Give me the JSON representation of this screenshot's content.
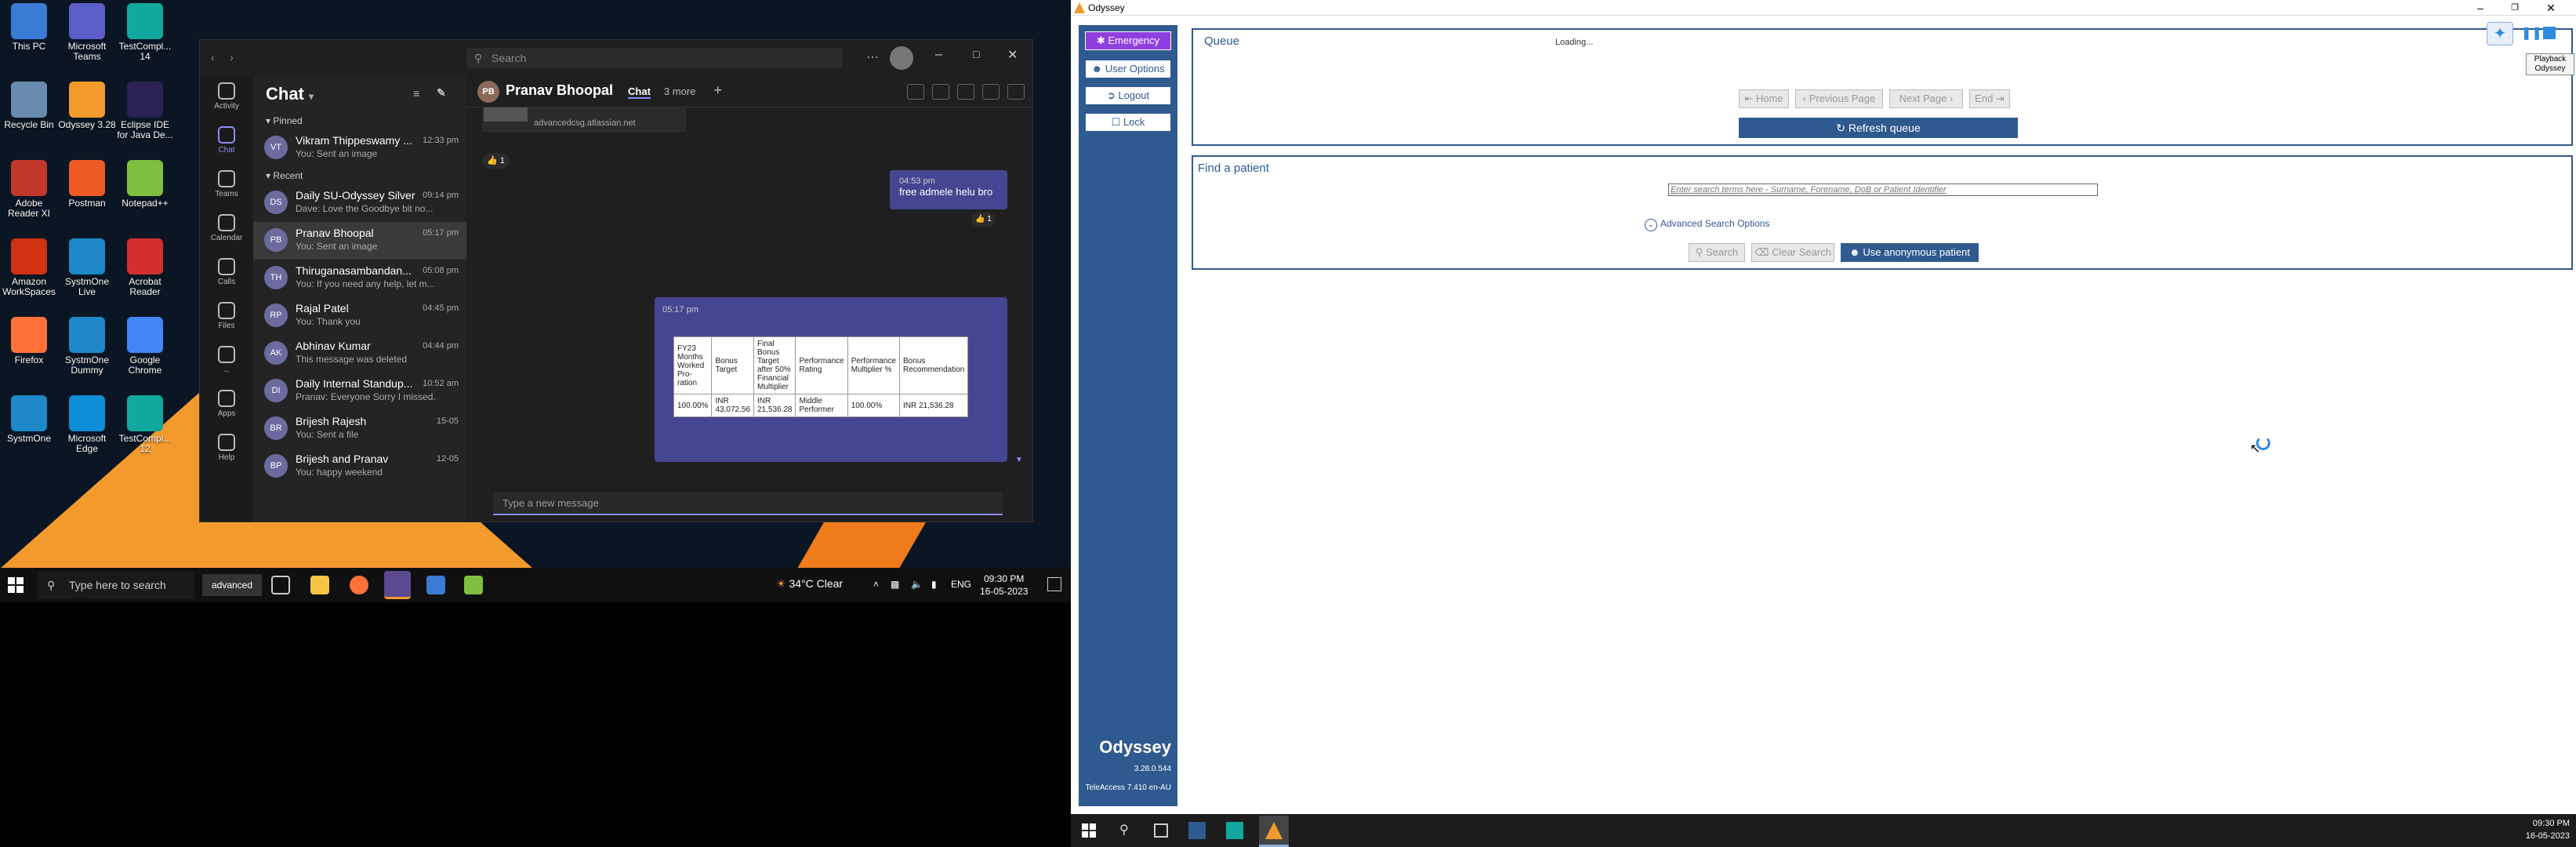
{
  "desktop": {
    "icons": [
      {
        "label": "This PC",
        "color": "#3a7bd5"
      },
      {
        "label": "Microsoft Teams",
        "color": "#5b5fc7"
      },
      {
        "label": "TestCompl... 14",
        "color": "#13a89e"
      },
      {
        "label": "Recycle Bin",
        "color": "#6a8bb0"
      },
      {
        "label": "Odyssey 3.28",
        "color": "#f39a2c"
      },
      {
        "label": "Eclipse IDE for Java De...",
        "color": "#2c2255"
      },
      {
        "label": "Adobe Reader XI",
        "color": "#c0392b"
      },
      {
        "label": "Postman",
        "color": "#ef5b25"
      },
      {
        "label": "Notepad++",
        "color": "#7fbf3f"
      },
      {
        "label": "Amazon WorkSpaces",
        "color": "#d13212"
      },
      {
        "label": "SystmOne Live",
        "color": "#1e88c8"
      },
      {
        "label": "Acrobat Reader",
        "color": "#d32f2f"
      },
      {
        "label": "Firefox",
        "color": "#ff7139"
      },
      {
        "label": "SystmOne Dummy",
        "color": "#1e88c8"
      },
      {
        "label": "Google Chrome",
        "color": "#4285f4"
      },
      {
        "label": "SystmOne",
        "color": "#1e88c8"
      },
      {
        "label": "Microsoft Edge",
        "color": "#0c8fd6"
      },
      {
        "label": "TestCompl... 12",
        "color": "#13a89e"
      }
    ]
  },
  "teams": {
    "search_placeholder": "Search",
    "rail": [
      "Activity",
      "Chat",
      "Teams",
      "Calendar",
      "Calls",
      "Files",
      "...",
      "Apps",
      "Help"
    ],
    "chat_title": "Chat",
    "pinned_label": "Pinned",
    "recent_label": "Recent",
    "pinned": [
      {
        "name": "Vikram Thippeswamy ...",
        "preview": "You: Sent an image",
        "time": "12:33 pm",
        "initials": "VT"
      }
    ],
    "recent": [
      {
        "name": "Daily SU-Odyssey Silver",
        "preview": "Dave: Love the Goodbye bit no...",
        "time": "09:14 pm",
        "initials": "DS"
      },
      {
        "name": "Pranav Bhoopal",
        "preview": "You: Sent an image",
        "time": "05:17 pm",
        "initials": "PB"
      },
      {
        "name": "Thiruganasambandan...",
        "preview": "You: If you need any help, let m...",
        "time": "05:08 pm",
        "initials": "TH"
      },
      {
        "name": "Rajal Patel",
        "preview": "You: Thank you",
        "time": "04:45 pm",
        "initials": "RP"
      },
      {
        "name": "Abhinav Kumar",
        "preview": "This message was deleted",
        "time": "04:44 pm",
        "initials": "AK"
      },
      {
        "name": "Daily Internal Standup...",
        "preview": "Pranav: Everyone Sorry I missed...",
        "time": "10:52 am",
        "initials": "DI"
      },
      {
        "name": "Brijesh Rajesh",
        "preview": "You: Sent a file",
        "time": "15-05",
        "initials": "BR"
      },
      {
        "name": "Brijesh and Pranav",
        "preview": "You: happy weekend",
        "time": "12-05",
        "initials": "BP"
      }
    ],
    "conversation": {
      "contact": "Pranav Bhoopal",
      "contact_initials": "PB",
      "tab_chat": "Chat",
      "tab_more": "3 more",
      "link_text": "advancedcsg.atlassian.net",
      "reaction_count_1": "1",
      "msg1_time": "04:53 pm",
      "msg1_text": "free admele helu bro",
      "reaction_count_2": "1",
      "msg2_time": "05:17 pm",
      "table_headers": [
        "FY23 Months Worked Pro-ration",
        "Bonus Target",
        "Final Bonus Target after 50% Financial Multiplier",
        "Performance Rating",
        "Performance Multiplier %",
        "Bonus Recommendation"
      ],
      "table_row": [
        "100.00%",
        "INR 43,072.56",
        "INR 21,536.28",
        "Middle Performer",
        "100.00%",
        "INR 21,536.28"
      ],
      "input_placeholder": "Type a new message"
    }
  },
  "left_taskbar": {
    "search_placeholder": "Type here to search",
    "advanced_label": "advanced",
    "weather": "34°C  Clear",
    "language": "ENG",
    "time": "09:30 PM",
    "date": "16-05-2023"
  },
  "odyssey": {
    "window_title": "Odyssey",
    "sidebar": {
      "emergency": "Emergency",
      "user_options": "User Options",
      "logout": "Logout",
      "lock": "Lock",
      "brand": "Odyssey",
      "version": "3.28.0.544",
      "teleaccess": "TeleAccess 7.410 en-AU"
    },
    "queue": {
      "title": "Queue",
      "loading": "Loading...",
      "home": "Home",
      "previous_page": "Previous Page",
      "next_page": "Next Page",
      "end": "End",
      "refresh": "Refresh queue"
    },
    "find": {
      "title": "Find a patient",
      "search_placeholder": "Enter search terms here - Surname, Forename, DoB or Patient Identifier",
      "advanced": "Advanced Search Options",
      "search": "Search",
      "clear_search": "Clear Search",
      "anonymous": "Use anonymous patient"
    },
    "playback_tooltip_line1": "Playback",
    "playback_tooltip_line2": "Odyssey"
  },
  "right_taskbar": {
    "time": "09:30 PM",
    "date": "16-05-2023"
  }
}
